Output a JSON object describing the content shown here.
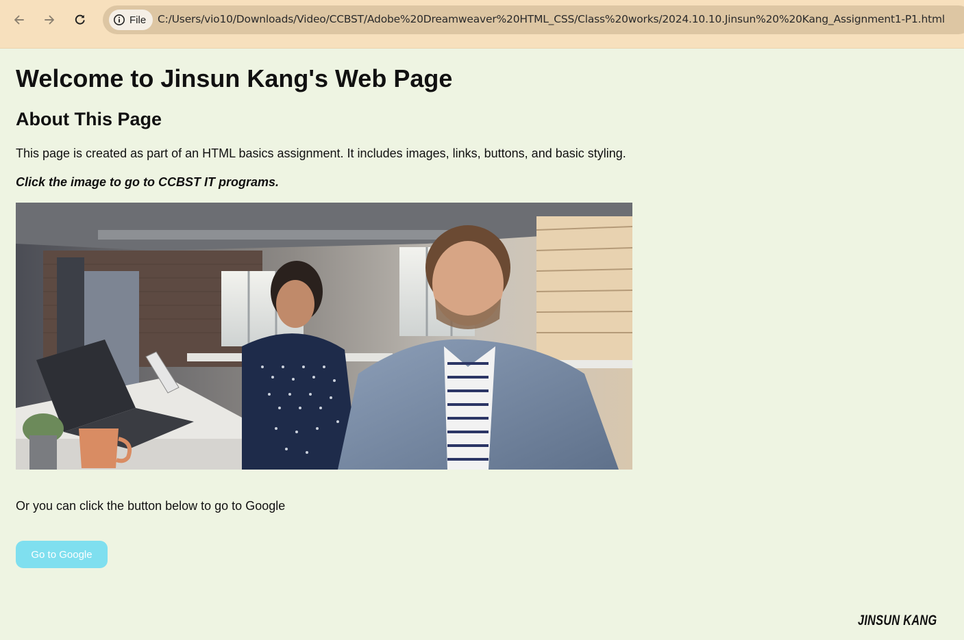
{
  "browser": {
    "site_chip_label": "File",
    "url": "C:/Users/vio10/Downloads/Video/CCBST/Adobe%20Dreamweaver%20HTML_CSS/Class%20works/2024.10.10.Jinsun%20%20Kang_Assignment1-P1.html",
    "icons": [
      "back-arrow-icon",
      "forward-arrow-icon",
      "reload-icon",
      "info-icon"
    ],
    "toolbar_color": "#f7e0bd"
  },
  "page": {
    "title": "Welcome to Jinsun Kang's Web Page",
    "section_heading": "About This Page",
    "intro": "This page is created as part of an HTML basics assignment. It includes images, links, buttons, and basic styling.",
    "click_note": "Click the image to go to CCBST IT programs.",
    "google_note": "Or you can click the button below to go to Google",
    "google_button_label": "Go to Google",
    "signature": "JINSUN KANG",
    "background_color": "#eef4e2",
    "button_color": "#7fdfef"
  }
}
